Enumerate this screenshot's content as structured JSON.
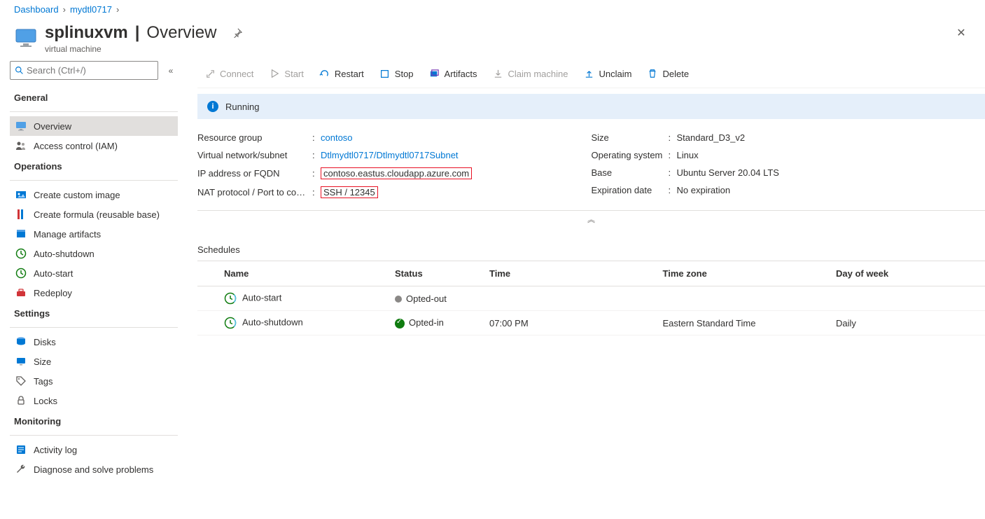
{
  "breadcrumb": {
    "items": [
      "Dashboard",
      "mydtl0717"
    ]
  },
  "header": {
    "name": "splinuxvm",
    "section": "Overview",
    "subtitle": "virtual machine"
  },
  "sidebar": {
    "search_placeholder": "Search (Ctrl+/)",
    "groups": {
      "general_title": "General",
      "operations_title": "Operations",
      "settings_title": "Settings",
      "monitoring_title": "Monitoring"
    },
    "items": {
      "overview": "Overview",
      "access_control": "Access control (IAM)",
      "create_custom_image": "Create custom image",
      "create_formula": "Create formula (reusable base)",
      "manage_artifacts": "Manage artifacts",
      "auto_shutdown": "Auto-shutdown",
      "auto_start": "Auto-start",
      "redeploy": "Redeploy",
      "disks": "Disks",
      "size": "Size",
      "tags": "Tags",
      "locks": "Locks",
      "activity_log": "Activity log",
      "diagnose": "Diagnose and solve problems"
    }
  },
  "toolbar": {
    "connect": "Connect",
    "start": "Start",
    "restart": "Restart",
    "stop": "Stop",
    "artifacts": "Artifacts",
    "claim_machine": "Claim machine",
    "unclaim": "Unclaim",
    "delete": "Delete"
  },
  "status": {
    "text": "Running"
  },
  "essentials": {
    "left": {
      "resource_group_key": "Resource group",
      "resource_group_val": "contoso",
      "vnet_key": "Virtual network/subnet",
      "vnet_val": "Dtlmydtl0717/Dtlmydtl0717Subnet",
      "ip_key": "IP address or FQDN",
      "ip_val": "contoso.eastus.cloudapp.azure.com",
      "nat_key": "NAT protocol / Port to co…",
      "nat_val": "SSH / 12345"
    },
    "right": {
      "size_key": "Size",
      "size_val": "Standard_D3_v2",
      "os_key": "Operating system",
      "os_val": "Linux",
      "base_key": "Base",
      "base_val": "Ubuntu Server 20.04 LTS",
      "exp_key": "Expiration date",
      "exp_val": "No expiration"
    }
  },
  "schedules": {
    "title": "Schedules",
    "headers": {
      "name": "Name",
      "status": "Status",
      "time": "Time",
      "tz": "Time zone",
      "day": "Day of week"
    },
    "rows": [
      {
        "name": "Auto-start",
        "status": "Opted-out",
        "time": "",
        "tz": "",
        "day": "",
        "opted_in": false
      },
      {
        "name": "Auto-shutdown",
        "status": "Opted-in",
        "time": "07:00 PM",
        "tz": "Eastern Standard Time",
        "day": "Daily",
        "opted_in": true
      }
    ]
  }
}
